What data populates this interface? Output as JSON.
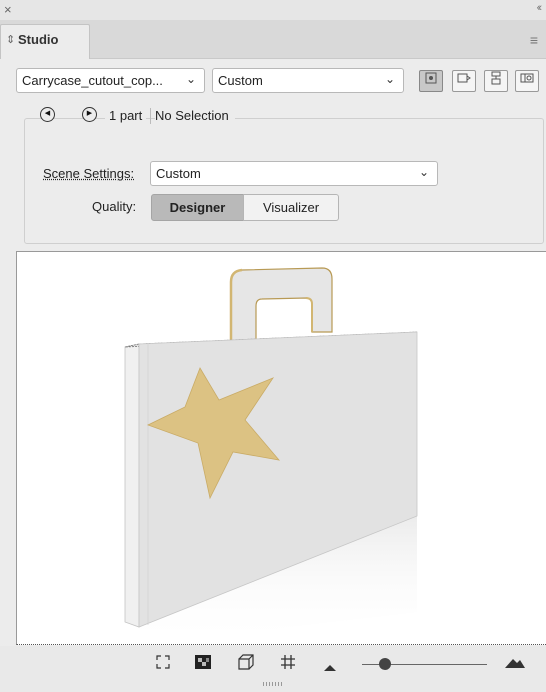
{
  "window": {
    "close_glyph": "×",
    "collapse_glyph": "‹‹"
  },
  "tab": {
    "label": "Studio",
    "icon": "sort-arrows-icon"
  },
  "menu_icon": "hamburger-icon",
  "file_select": {
    "value": "Carrycase_cutout_cop..."
  },
  "view_select": {
    "value": "Custom"
  },
  "view_buttons": [
    {
      "name": "assembled-view-icon",
      "active": true
    },
    {
      "name": "fold-view-icon",
      "active": false
    },
    {
      "name": "exploded-view-icon",
      "active": false
    },
    {
      "name": "flat-view-icon",
      "active": false
    }
  ],
  "part_nav": {
    "parts_label": "1 part",
    "selection_label": "No Selection"
  },
  "scene_settings": {
    "label": "Scene Settings:",
    "value": "Custom"
  },
  "quality": {
    "label": "Quality:",
    "options": [
      "Designer",
      "Visualizer"
    ],
    "selected": "Designer"
  },
  "colors": {
    "star_fill": "#dcc283",
    "box_face": "#e2e2e2",
    "box_side": "#ececec",
    "selected_seg": "#b9b9b9"
  },
  "toolbar": {
    "icons": [
      "fit-view-icon",
      "background-toggle-icon",
      "wireframe-cube-icon",
      "grid-icon",
      "zoom-out-icon",
      "zoom-in-icon"
    ],
    "zoom_level": 0.18
  }
}
